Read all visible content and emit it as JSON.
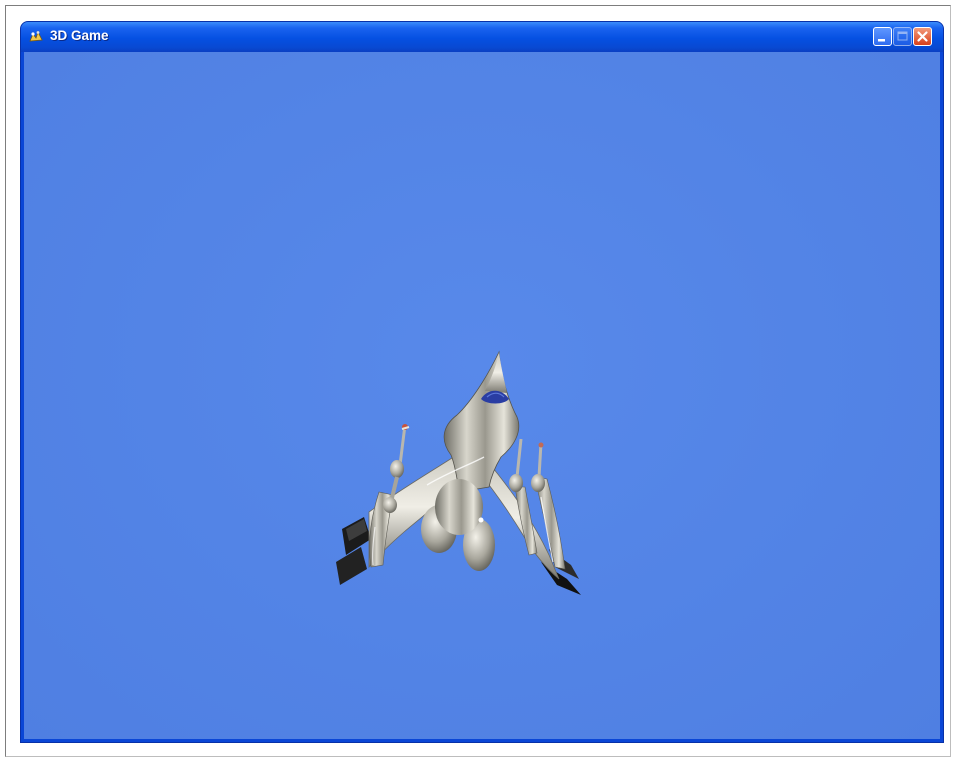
{
  "window": {
    "title": "3D Game",
    "app_icon": "dx-app-icon",
    "controls": [
      "minimize-button",
      "maximize-button",
      "close-button"
    ],
    "titlebar_color": "#0550e2"
  },
  "scene": {
    "background_color": "#5384e6",
    "object": "spaceship-model"
  }
}
